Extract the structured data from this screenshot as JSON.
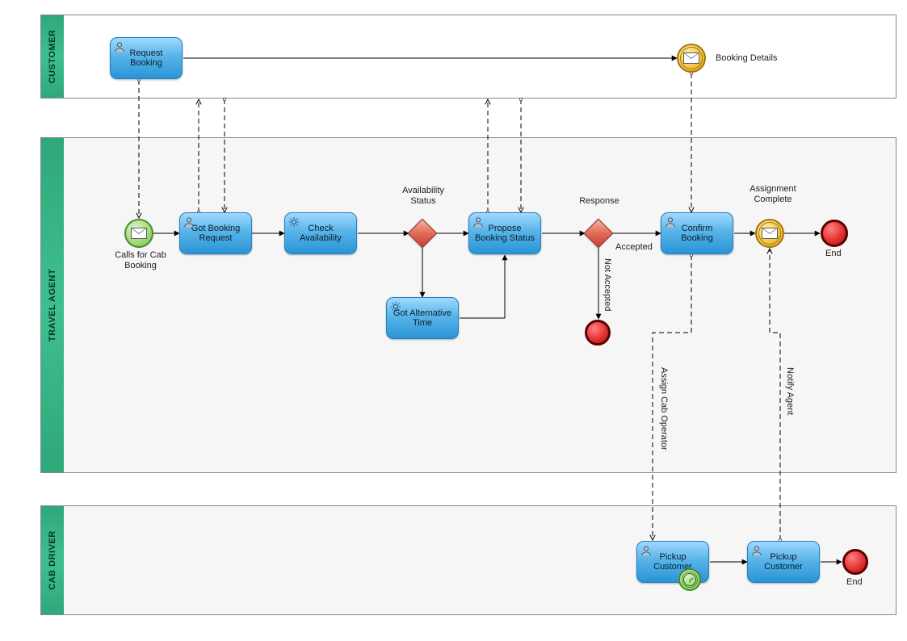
{
  "pools": {
    "customer": "CUSTOMER",
    "agent": "TRAVEL AGENT",
    "driver": "CAB DRIVER"
  },
  "tasks": {
    "request_booking": "Request Booking",
    "got_booking_request": "Got Booking Request",
    "check_availability": "Check Availability",
    "got_alternative_time": "Got Alternative Time",
    "propose_booking_status": "Propose Booking Status",
    "confirm_booking": "Confirm Booking",
    "pickup_customer_1": "Pickup Customer",
    "pickup_customer_2": "Pickup Customer"
  },
  "events": {
    "calls_for_cab_booking": "Calls for Cab Booking",
    "booking_details": "Booking Details",
    "assignment_complete": "Assignment Complete",
    "end_agent": "End",
    "end_driver": "End"
  },
  "gateways": {
    "availability_status": "Availability Status",
    "response": "Response"
  },
  "edges": {
    "accepted": "Accepted",
    "not_accepted": "Not Accepted",
    "assign_cab_operator": "Assign Cab Operator",
    "notify_agent": "Notify Agent"
  }
}
